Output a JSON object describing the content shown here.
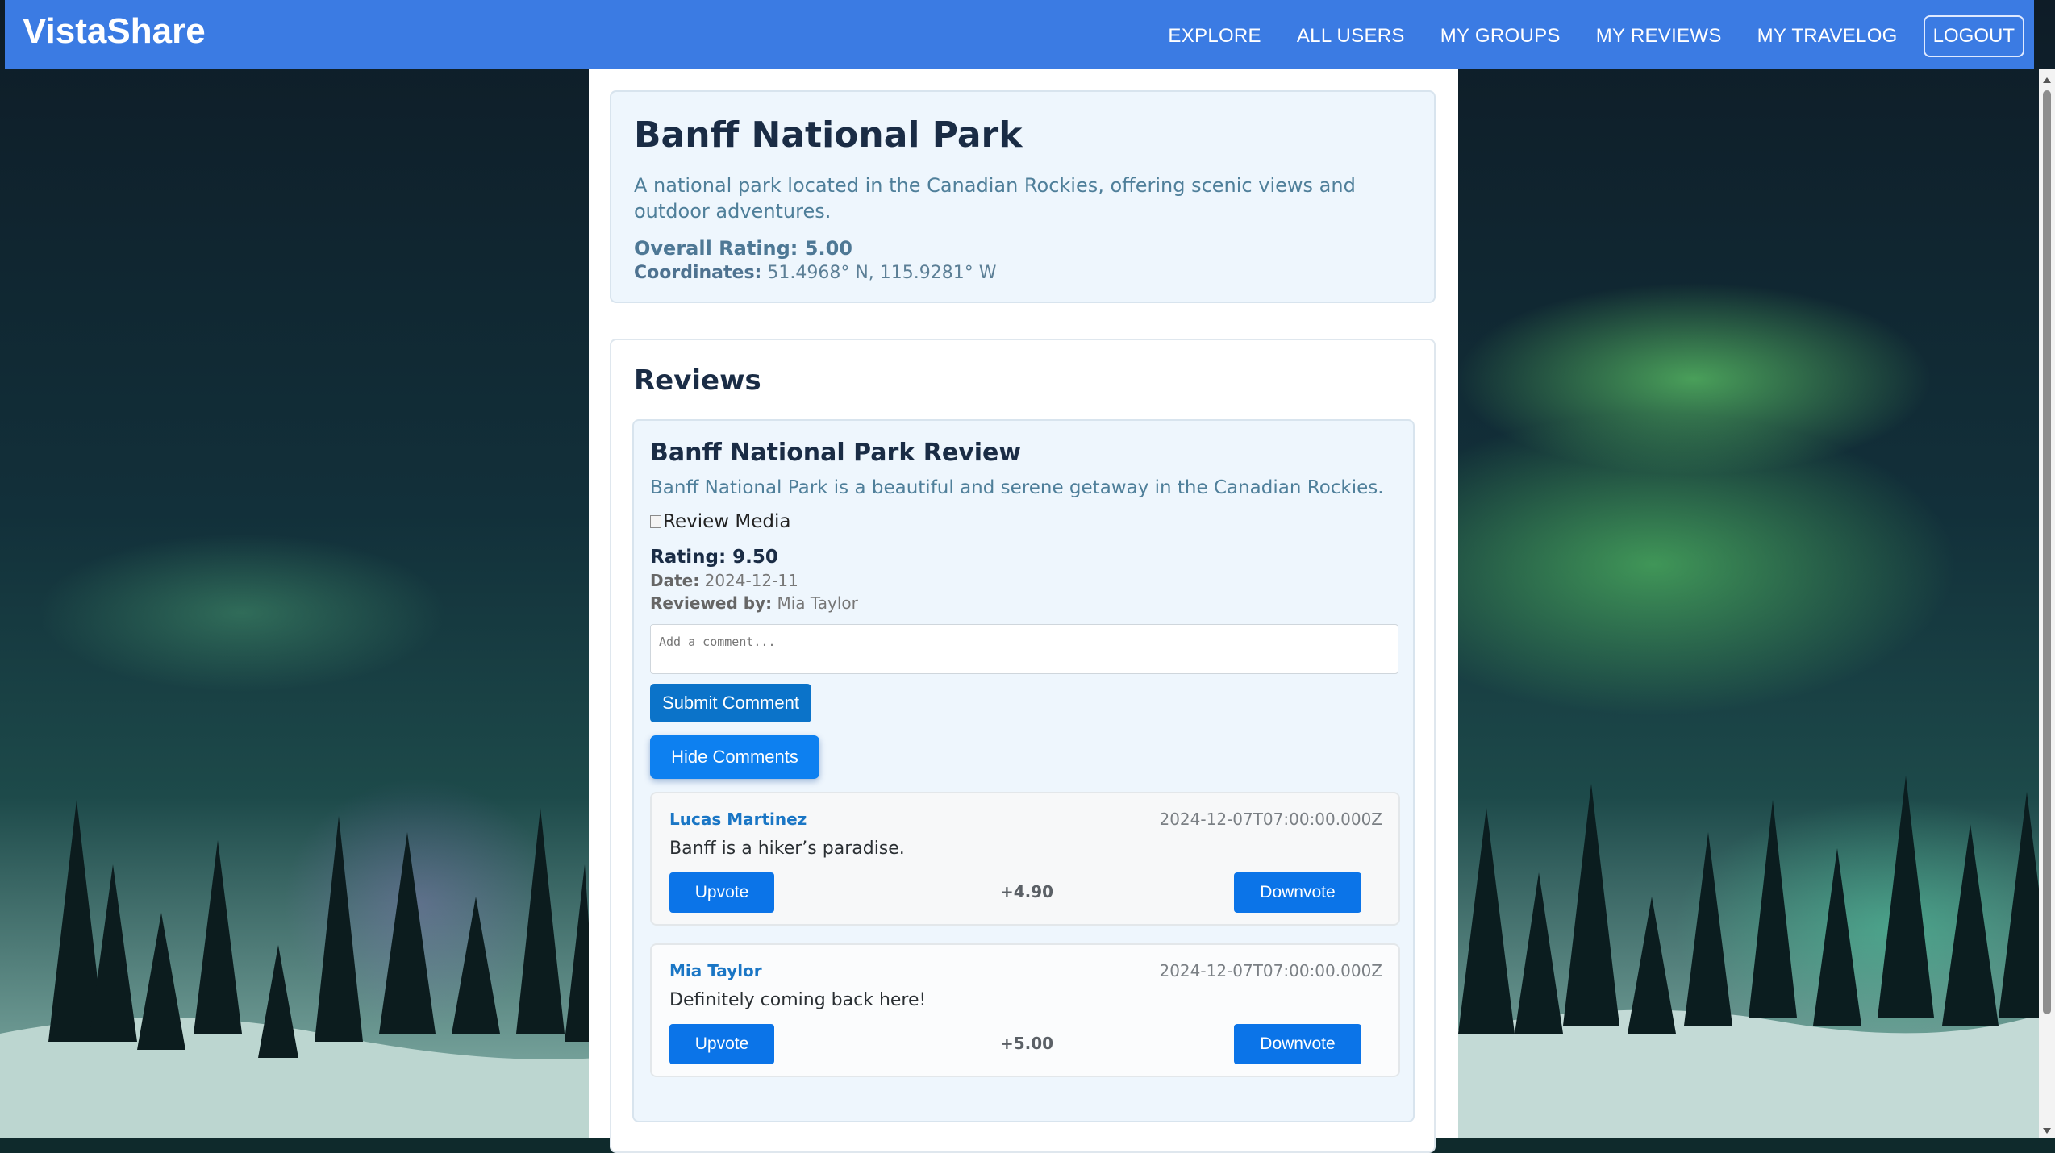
{
  "app": {
    "brand": "VistaShare"
  },
  "nav": {
    "items": [
      "EXPLORE",
      "ALL USERS",
      "MY GROUPS",
      "MY REVIEWS",
      "MY TRAVELOG"
    ],
    "logout": "LOGOUT"
  },
  "park": {
    "title": "Banff National Park",
    "description": "A national park located in the Canadian Rockies, offering scenic views and outdoor adventures.",
    "rating_text": "Overall Rating: 5.00",
    "coords_label": "Coordinates:",
    "coords_value": "51.4968° N, 115.9281° W"
  },
  "reviews": {
    "heading": "Reviews",
    "items": [
      {
        "title": "Banff National Park Review",
        "text": "Banff National Park is a beautiful and serene getaway in the Canadian Rockies.",
        "media_alt": "Review Media",
        "rating_text": "Rating: 9.50",
        "date_label": "Date:",
        "date_value": "2024-12-11",
        "by_label": "Reviewed by:",
        "by_value": "Mia Taylor",
        "comment_placeholder": "Add a comment...",
        "submit_label": "Submit Comment",
        "hide_label": "Hide Comments",
        "comments": [
          {
            "author": "Lucas Martinez",
            "date": "2024-12-07T07:00:00.000Z",
            "text": "Banff is a hiker’s paradise.",
            "upvote": "Upvote",
            "score": "+4.90",
            "downvote": "Downvote"
          },
          {
            "author": "Mia Taylor",
            "date": "2024-12-07T07:00:00.000Z",
            "text": "Definitely coming back here!",
            "upvote": "Upvote",
            "score": "+5.00",
            "downvote": "Downvote"
          }
        ]
      }
    ]
  },
  "colors": {
    "navbar": "#3b7be3",
    "primary_button": "#0b73c9",
    "card_background": "#eef6fd",
    "heading": "#1a2c45",
    "muted_text": "#4f7f9a",
    "author_link": "#1a76c5"
  },
  "icons": [
    "broken-image-icon",
    "scroll-up-arrow-icon",
    "scroll-down-arrow-icon"
  ]
}
